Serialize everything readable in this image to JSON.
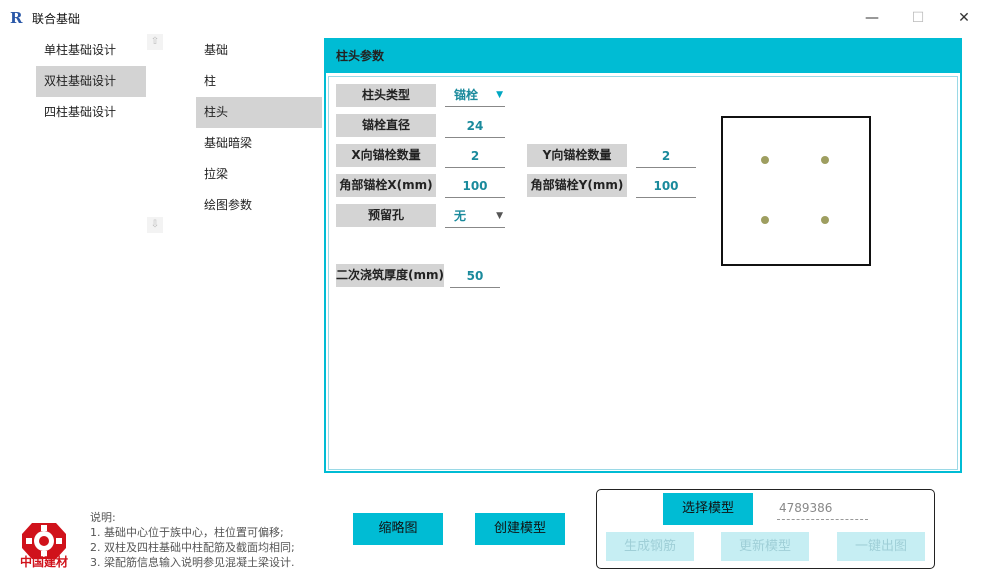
{
  "window": {
    "app_icon": "R",
    "title": "联合基础",
    "minimize": "—",
    "maximize": "☐",
    "close": "✕"
  },
  "left_nav": {
    "items": [
      "单柱基础设计",
      "双柱基础设计",
      "四柱基础设计"
    ],
    "selected_index": 1,
    "scroll_up": "⇧",
    "scroll_down": "⇩"
  },
  "mid_nav": {
    "items": [
      "基础",
      "柱",
      "柱头",
      "基础暗梁",
      "拉梁",
      "绘图参数"
    ],
    "selected_index": 2
  },
  "panel": {
    "title": "柱头参数",
    "fields": {
      "head_type": {
        "label": "柱头类型",
        "value": "锚栓"
      },
      "anchor_diameter": {
        "label": "锚栓直径",
        "value": "24"
      },
      "x_anchor_count": {
        "label": "X向锚栓数量",
        "value": "2"
      },
      "y_anchor_count": {
        "label": "Y向锚栓数量",
        "value": "2"
      },
      "corner_anchor_x": {
        "label": "角部锚栓X(mm)",
        "value": "100"
      },
      "corner_anchor_y": {
        "label": "角部锚栓Y(mm)",
        "value": "100"
      },
      "reserved_hole": {
        "label": "预留孔",
        "value": "无"
      },
      "grout_thickness": {
        "label": "二次浇筑厚度(mm)",
        "value": "50"
      }
    }
  },
  "notes": {
    "heading": "说明:",
    "lines": [
      "1. 基础中心位于族中心，柱位置可偏移;",
      "2. 双柱及四柱基础中柱配筋及截面均相同;",
      "3. 梁配筋信息输入说明参见混凝土梁设计."
    ]
  },
  "logo": {
    "text": "中国建材"
  },
  "buttons": {
    "thumbnail": "缩略图",
    "create_model": "创建模型",
    "select_model": "选择模型",
    "generate_rebar": "生成钢筋",
    "update_model": "更新模型",
    "one_click_drawing": "一键出图"
  },
  "model_id": "4789386",
  "colors": {
    "accent": "#00bcd4",
    "value_text": "#1a8a9c",
    "logo_red": "#d0121b"
  }
}
